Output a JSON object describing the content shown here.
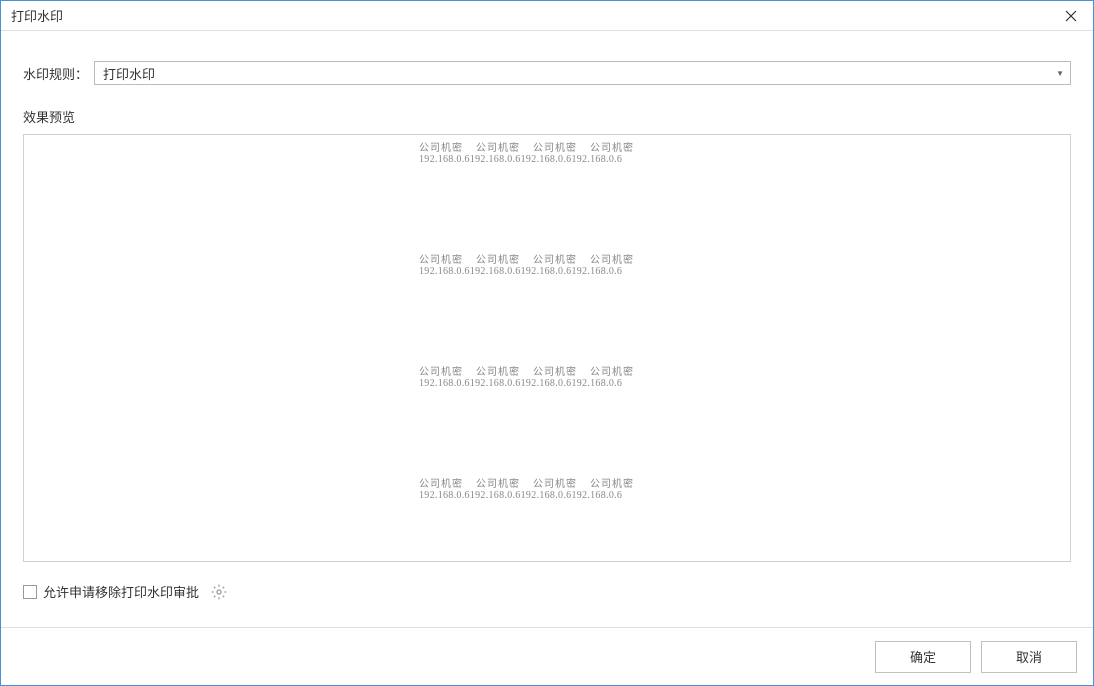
{
  "title": "打印水印",
  "rule": {
    "label": "水印规则：",
    "value": "打印水印"
  },
  "preview": {
    "label": "效果预览",
    "watermark": {
      "text": "公司机密",
      "ip": "192.168.0.6",
      "columns": 4,
      "rows": 4
    }
  },
  "approval": {
    "checkbox_label": "允许申请移除打印水印审批",
    "checked": false
  },
  "buttons": {
    "ok": "确定",
    "cancel": "取消"
  }
}
